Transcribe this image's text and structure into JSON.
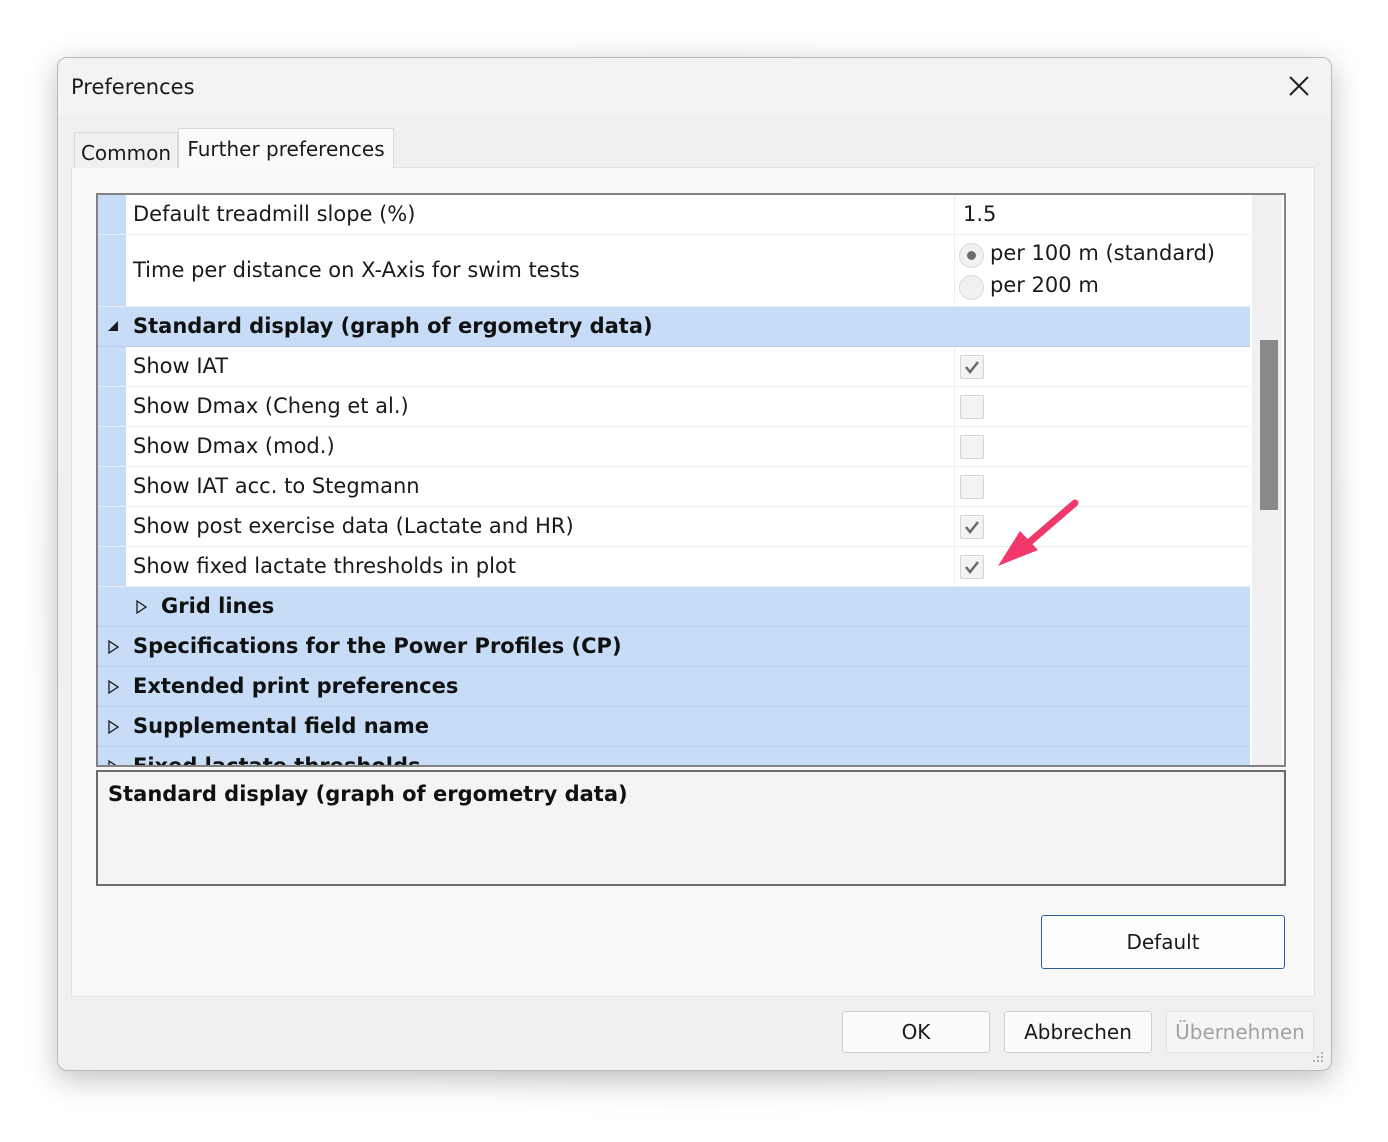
{
  "window": {
    "title": "Preferences",
    "close_icon": "close-icon"
  },
  "tabs": [
    {
      "label": "Common",
      "selected": false
    },
    {
      "label": "Further preferences",
      "selected": true
    }
  ],
  "grid": {
    "rows": {
      "treadmill": {
        "label": "Default treadmill slope (%)",
        "value": "1.5"
      },
      "swim": {
        "label": "Time per distance on X-Axis for swim tests",
        "options": [
          {
            "label": "per 100 m (standard)",
            "selected": true
          },
          {
            "label": "per 200 m",
            "selected": false
          }
        ]
      },
      "standard_display": {
        "label": "Standard display (graph of ergometry data)",
        "expanded": true
      },
      "show_iat": {
        "label": "Show IAT",
        "checked": true
      },
      "show_dmax_cheng": {
        "label": "Show Dmax (Cheng et al.)",
        "checked": false
      },
      "show_dmax_mod": {
        "label": "Show Dmax (mod.)",
        "checked": false
      },
      "show_iat_stegmann": {
        "label": "Show IAT acc. to Stegmann",
        "checked": false
      },
      "show_post_exercise": {
        "label": "Show post exercise data (Lactate and HR)",
        "checked": true
      },
      "show_fixed_lactate": {
        "label": "Show fixed lactate thresholds in plot",
        "checked": true
      },
      "grid_lines": {
        "label": "Grid lines",
        "expanded": false
      },
      "power_profiles": {
        "label": "Specifications for the Power Profiles (CP)",
        "expanded": false
      },
      "extended_print": {
        "label": "Extended print preferences",
        "expanded": false
      },
      "supplemental": {
        "label": "Supplemental field name",
        "expanded": false
      },
      "fixed_lactate": {
        "label": "Fixed lactate thresholds",
        "expanded": false
      }
    }
  },
  "description": {
    "title": "Standard display (graph of ergometry data)"
  },
  "buttons": {
    "default": "Default",
    "ok": "OK",
    "cancel": "Abbrechen",
    "apply": "Übernehmen"
  },
  "colors": {
    "category_bg": "#c7ddf7",
    "annotation_arrow": "#f0386b",
    "default_button_border": "#2a5fa0"
  }
}
